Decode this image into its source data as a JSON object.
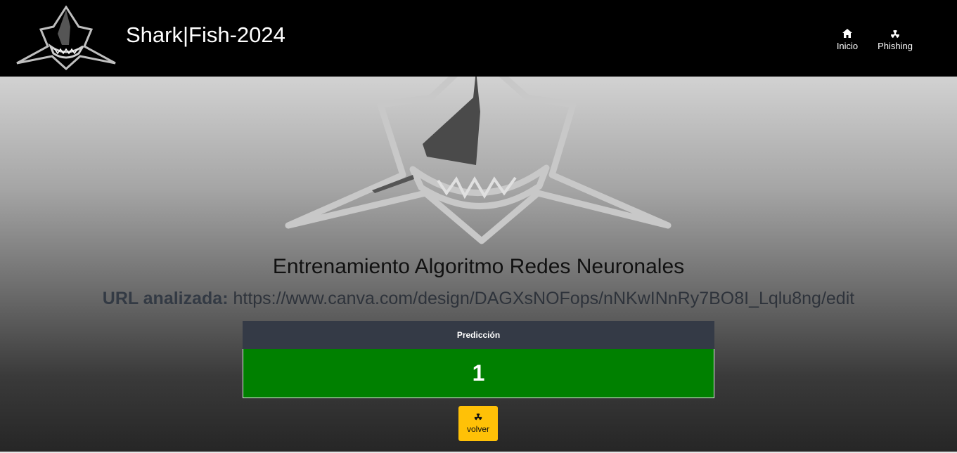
{
  "navbar": {
    "brand_title": "Shark|Fish-2024",
    "logo_icon": "shark-logo-icon",
    "items": [
      {
        "label": "Inicio",
        "icon": "home-icon"
      },
      {
        "label": "Phishing",
        "icon": "radiation-icon"
      }
    ]
  },
  "main": {
    "title": "Entrenamiento Algoritmo Redes Neuronales",
    "url_label": "URL analizada:",
    "url_value": "https://www.canva.com/design/DAGXsNOFops/nNKwINnRy7BO8I_Lqlu8ng/edit",
    "table": {
      "header": "Predicción",
      "value": "1"
    },
    "back_button": {
      "label": "volver",
      "icon": "radiation-icon"
    }
  },
  "colors": {
    "navbar_bg": "#000000",
    "table_header_bg": "#343a46",
    "prediction_bg": "#008000",
    "button_bg": "#ffc107"
  }
}
